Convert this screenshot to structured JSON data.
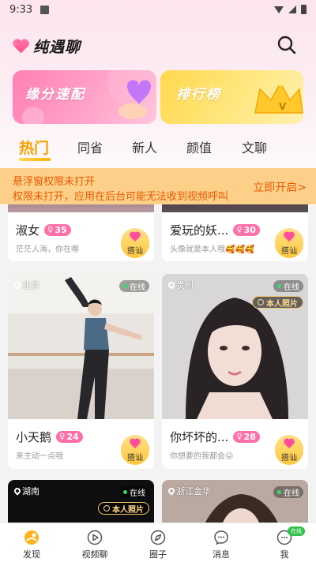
{
  "status_bar": {
    "time": "9:33"
  },
  "header": {
    "app_title": "纯遇聊",
    "search_icon": "search-icon"
  },
  "banners": [
    {
      "label": "缘分速配",
      "color": "#ff8fbf"
    },
    {
      "label": "排行榜",
      "color": "#ffd84d"
    }
  ],
  "tabs": [
    {
      "label": "热门",
      "active": true
    },
    {
      "label": "同省",
      "active": false
    },
    {
      "label": "新人",
      "active": false
    },
    {
      "label": "颜值",
      "active": false
    },
    {
      "label": "文聊",
      "active": false
    }
  ],
  "notice": {
    "title": "悬浮窗权限未打开",
    "text": "权限未打开，应用在后台可能无法收到视频呼叫",
    "action": "立即开启>"
  },
  "cards": [
    {
      "name": "淑女",
      "age": "35",
      "gender_icon": "female-icon",
      "bio": "茫茫人海，你在哪",
      "chat_label": "搭讪"
    },
    {
      "name": "爱玩的妖...",
      "age": "30",
      "gender_icon": "female-icon",
      "bio": "头像就是本人哦🥰🥰🥰",
      "chat_label": "搭讪"
    },
    {
      "name": "小天鹅",
      "age": "24",
      "gender_icon": "female-icon",
      "bio": "来主动一点哦",
      "chat_label": "搭讪",
      "location": "北京",
      "online": "在线"
    },
    {
      "name": "你坏坏的...",
      "age": "28",
      "gender_icon": "female-icon",
      "bio": "你想要的我都会😜",
      "chat_label": "搭讪",
      "location": "贵州",
      "online": "在线",
      "verified": "本人照片"
    },
    {
      "location": "湖南",
      "online": "在线",
      "verified": "本人照片"
    },
    {
      "location": "浙江金华",
      "online": "在线"
    }
  ],
  "bottom_nav": [
    {
      "label": "发现",
      "icon": "discover-icon",
      "active": true
    },
    {
      "label": "视频聊",
      "icon": "video-chat-icon",
      "active": false
    },
    {
      "label": "圈子",
      "icon": "compass-icon",
      "active": false
    },
    {
      "label": "消息",
      "icon": "message-icon",
      "active": false
    },
    {
      "label": "我",
      "icon": "profile-icon",
      "active": false,
      "badge": "在线"
    }
  ],
  "colors": {
    "accent": "#f5a300",
    "pink": "#ff6fa8",
    "notice_bg": "#fdd08a",
    "notice_text": "#e65a00",
    "online": "#2fe06b"
  }
}
